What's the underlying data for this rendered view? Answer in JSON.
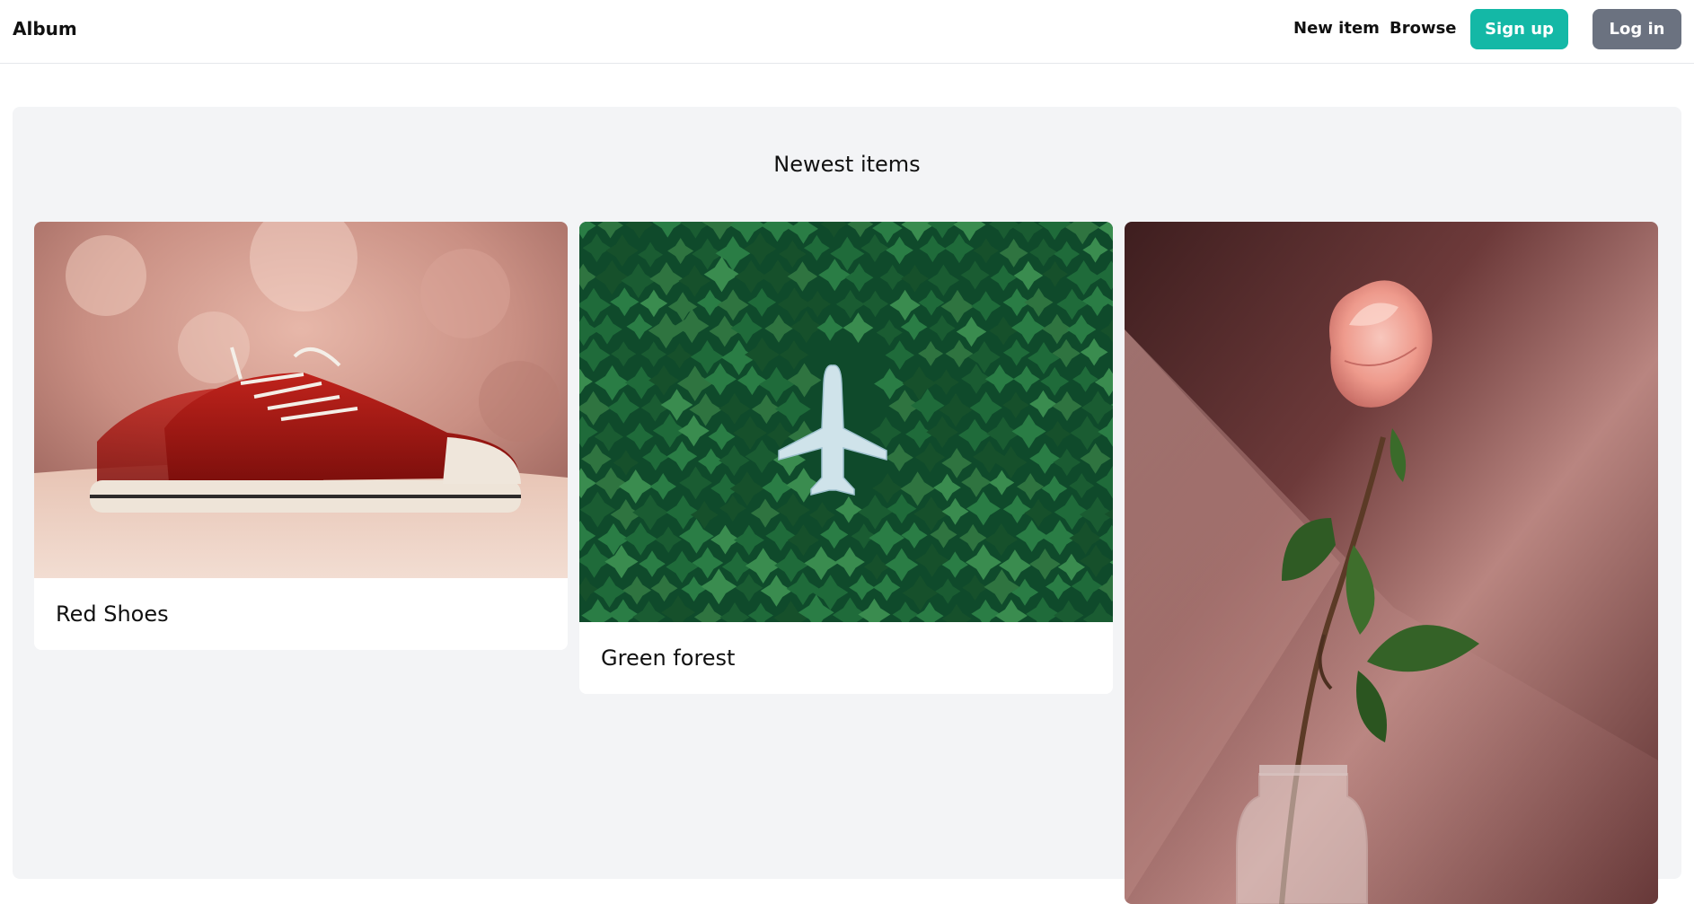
{
  "nav": {
    "brand": "Album",
    "links": [
      "New item",
      "Browse"
    ],
    "signup_label": "Sign up",
    "login_label": "Log in"
  },
  "main": {
    "title": "Newest items",
    "items": [
      {
        "label": "Red Shoes",
        "image": "red-sneakers-photo"
      },
      {
        "label": "Green forest",
        "image": "airplane-in-forest-photo"
      },
      {
        "label": "",
        "image": "pink-rose-in-vase-photo"
      }
    ]
  },
  "colors": {
    "signup": "#14b8a6",
    "login": "#6b7280",
    "panel": "#f3f4f6"
  }
}
